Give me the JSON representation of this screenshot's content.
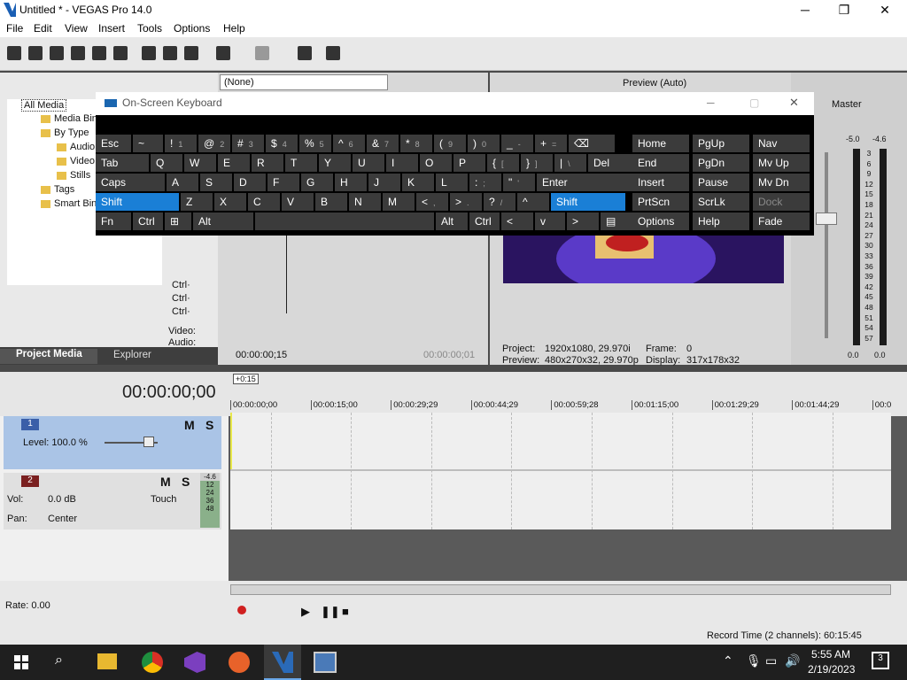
{
  "window": {
    "title": "Untitled * - VEGAS Pro 14.0",
    "minimize": "─",
    "maximize": "❐",
    "close": "✕"
  },
  "menu": [
    "File",
    "Edit",
    "View",
    "Insert",
    "Tools",
    "Options",
    "Help"
  ],
  "project_media": {
    "tree": [
      "All Media",
      "Media Bins",
      "By Type",
      "Audio",
      "Video",
      "Stills",
      "Tags",
      "Smart Bins"
    ],
    "tabs": [
      "Project Media",
      "Explorer"
    ],
    "side_labels": [
      "Ctrl·",
      "Ctrl·",
      "Ctrl·",
      "Video:",
      "Audio:"
    ]
  },
  "trimmer": {
    "preset": "(None)",
    "timecode": "00:00:00;15",
    "timecode_end": "00:00:00;01"
  },
  "preview": {
    "mode": "Preview (Auto)",
    "project_label": "Project:",
    "project_value": "1920x1080, 29.970i",
    "preview_label": "Preview:",
    "preview_value": "480x270x32, 29.970p",
    "frame_label": "Frame:",
    "frame_value": "0",
    "display_label": "Display:",
    "display_value": "317x178x32"
  },
  "master": {
    "label": "Master",
    "left_level": "-5.0",
    "right_level": "-4.6",
    "left_bottom": "0.0",
    "right_bottom": "0.0",
    "scale": [
      "3",
      "6",
      "9",
      "12",
      "15",
      "18",
      "21",
      "24",
      "27",
      "30",
      "33",
      "36",
      "39",
      "42",
      "45",
      "48",
      "51",
      "54",
      "57"
    ]
  },
  "osk": {
    "title": "On-Screen Keyboard",
    "rows": [
      [
        [
          "Esc",
          ""
        ],
        [
          "~",
          ""
        ],
        [
          "!",
          "1"
        ],
        [
          "@",
          "2"
        ],
        [
          "#",
          "3"
        ],
        [
          "$",
          "4"
        ],
        [
          "%",
          "5"
        ],
        [
          "^",
          "6"
        ],
        [
          "&",
          "7"
        ],
        [
          "*",
          "8"
        ],
        [
          "(",
          "9"
        ],
        [
          ")",
          "0"
        ],
        [
          "_",
          "-"
        ],
        [
          "+",
          "="
        ],
        [
          "⌫",
          ""
        ]
      ],
      [
        [
          "Tab",
          ""
        ],
        [
          "Q",
          ""
        ],
        [
          "W",
          ""
        ],
        [
          "E",
          ""
        ],
        [
          "R",
          ""
        ],
        [
          "T",
          ""
        ],
        [
          "Y",
          ""
        ],
        [
          "U",
          ""
        ],
        [
          "I",
          ""
        ],
        [
          "O",
          ""
        ],
        [
          "P",
          ""
        ],
        [
          "{",
          "["
        ],
        [
          "}",
          "]"
        ],
        [
          "|",
          "\\"
        ],
        [
          "Del",
          ""
        ]
      ],
      [
        [
          "Caps",
          ""
        ],
        [
          "A",
          ""
        ],
        [
          "S",
          ""
        ],
        [
          "D",
          ""
        ],
        [
          "F",
          ""
        ],
        [
          "G",
          ""
        ],
        [
          "H",
          ""
        ],
        [
          "J",
          ""
        ],
        [
          "K",
          ""
        ],
        [
          "L",
          ""
        ],
        [
          ":",
          ";"
        ],
        [
          "\"",
          "'"
        ],
        [
          "Enter",
          ""
        ]
      ],
      [
        [
          "Shift",
          ""
        ],
        [
          "Z",
          ""
        ],
        [
          "X",
          ""
        ],
        [
          "C",
          ""
        ],
        [
          "V",
          ""
        ],
        [
          "B",
          ""
        ],
        [
          "N",
          ""
        ],
        [
          "M",
          ""
        ],
        [
          "<",
          ","
        ],
        [
          ">",
          "."
        ],
        [
          "?",
          "/"
        ],
        [
          "^",
          ""
        ],
        [
          "Shift",
          ""
        ]
      ],
      [
        [
          "Fn",
          ""
        ],
        [
          "Ctrl",
          ""
        ],
        [
          "⊞",
          ""
        ],
        [
          "Alt",
          ""
        ],
        [
          "",
          ""
        ],
        [
          "Alt",
          ""
        ],
        [
          "Ctrl",
          ""
        ],
        [
          "<",
          ""
        ],
        [
          "v",
          ""
        ],
        [
          ">",
          ""
        ],
        [
          "▤",
          ""
        ]
      ]
    ],
    "nav": [
      [
        "Home",
        "PgUp",
        "Nav"
      ],
      [
        "End",
        "PgDn",
        "Mv Up"
      ],
      [
        "Insert",
        "Pause",
        "Mv Dn"
      ],
      [
        "PrtScn",
        "ScrLk",
        "Dock"
      ],
      [
        "Options",
        "Help",
        "Fade"
      ]
    ]
  },
  "timeline": {
    "timecode": "00:00:00;00",
    "offset": "+0:15",
    "ruler": [
      "00:00:00;00",
      "00:00:15;00",
      "00:00:29;29",
      "00:00:44;29",
      "00:00:59;28",
      "00:01:15;00",
      "00:01:29;29",
      "00:01:44;29",
      "00:0"
    ],
    "track1": {
      "num": "1",
      "level_label": "Level: 100.0 %",
      "m": "M",
      "s": "S"
    },
    "track2": {
      "num": "2",
      "vol_label": "Vol:",
      "vol_value": "0.0 dB",
      "pan_label": "Pan:",
      "pan_value": "Center",
      "touch": "Touch",
      "m": "M",
      "s": "S",
      "meter_top": "-4.6",
      "meter": [
        "12",
        "24",
        "36",
        "48"
      ]
    },
    "rate": "Rate: 0.00",
    "record_time": "Record Time (2 channels): 60:15:45"
  },
  "taskbar": {
    "time": "5:55 AM",
    "date": "2/19/2023",
    "notifications": "3"
  }
}
